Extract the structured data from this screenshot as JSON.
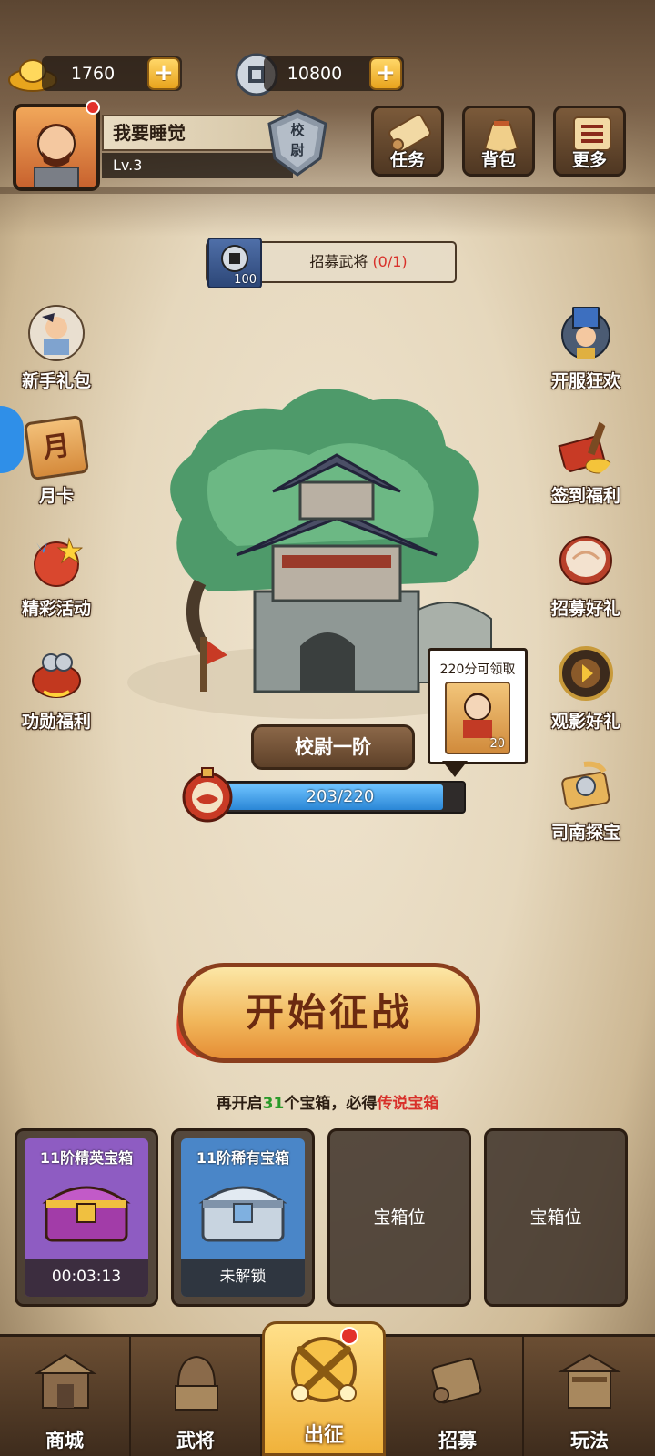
{
  "currency": {
    "gold": "1760",
    "coins": "10800"
  },
  "player": {
    "name": "我要睡觉",
    "level": "Lv.3",
    "rank_badge": "校尉"
  },
  "top_buttons": [
    {
      "label": "任务",
      "icon": "scroll-icon"
    },
    {
      "label": "背包",
      "icon": "bag-icon"
    },
    {
      "label": "更多",
      "icon": "menu-icon"
    }
  ],
  "recruit": {
    "cost": "100",
    "label": "招募武将",
    "progress": "(0/1)"
  },
  "left_icons": [
    {
      "label": "新手礼包",
      "icon": "newbie-gift-icon"
    },
    {
      "label": "月卡",
      "icon": "month-card-icon",
      "glyph": "月"
    },
    {
      "label": "精彩活动",
      "icon": "event-icon"
    },
    {
      "label": "功勋福利",
      "icon": "merit-icon"
    }
  ],
  "right_icons": [
    {
      "label": "开服狂欢",
      "icon": "server-carnival-icon"
    },
    {
      "label": "签到福利",
      "icon": "checkin-icon"
    },
    {
      "label": "招募好礼",
      "icon": "drum-icon"
    },
    {
      "label": "观影好礼",
      "icon": "video-reward-icon"
    },
    {
      "label": "司南探宝",
      "icon": "compass-icon"
    }
  ],
  "rank": {
    "title": "校尉一阶",
    "xp_text": "203/220",
    "xp_fraction": 0.923
  },
  "reward_bubble": {
    "label": "220分可领取",
    "count": "20"
  },
  "start_button": "开始征战",
  "chest_hint": {
    "prefix": "再开启",
    "count": "31",
    "middle": "个宝箱，必得",
    "highlight": "传说宝箱"
  },
  "chest_slots": [
    {
      "title": "11阶精英宝箱",
      "status": "00:03:13",
      "color": "#8e5cc2"
    },
    {
      "title": "11阶稀有宝箱",
      "status": "未解锁",
      "color": "#4a86c8"
    },
    {
      "label": "宝箱位"
    },
    {
      "label": "宝箱位"
    }
  ],
  "nav": [
    {
      "label": "商城",
      "icon": "shop-icon"
    },
    {
      "label": "武将",
      "icon": "general-icon"
    },
    {
      "label": "出征",
      "icon": "battle-icon"
    },
    {
      "label": "招募",
      "icon": "recruit-icon"
    },
    {
      "label": "玩法",
      "icon": "gameplay-icon"
    }
  ],
  "colors": {
    "accent_red": "#d8302a",
    "accent_green": "#2a9a2a",
    "xp_blue": "#2a86d6"
  }
}
